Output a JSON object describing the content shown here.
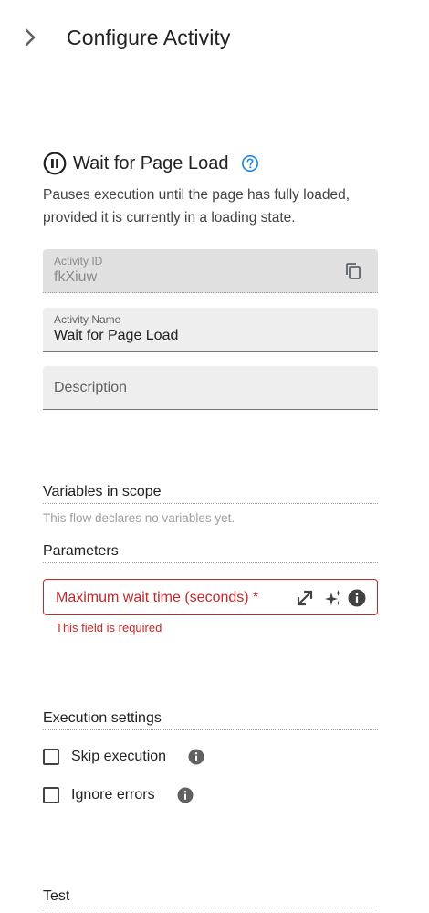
{
  "header": {
    "title": "Configure Activity"
  },
  "activity": {
    "title": "Wait for Page Load",
    "description": "Pauses execution until the page has fully loaded, provided it is currently in a loading state."
  },
  "fields": {
    "activity_id": {
      "label": "Activity ID",
      "value": "fkXiuw"
    },
    "activity_name": {
      "label": "Activity Name",
      "value": "Wait for Page Load"
    },
    "description": {
      "placeholder": "Description"
    }
  },
  "variables": {
    "heading": "Variables in scope",
    "empty_hint": "This flow declares no variables yet."
  },
  "parameters": {
    "heading": "Parameters",
    "max_wait": {
      "label": "Maximum wait time (seconds) *",
      "error": "This field is required"
    }
  },
  "execution": {
    "heading": "Execution settings",
    "skip_label": "Skip execution",
    "skip_checked": false,
    "ignore_label": "Ignore errors",
    "ignore_checked": false
  },
  "test": {
    "heading": "Test"
  },
  "colors": {
    "error": "#c62828",
    "help": "#1e88e5",
    "text": "#212121"
  }
}
